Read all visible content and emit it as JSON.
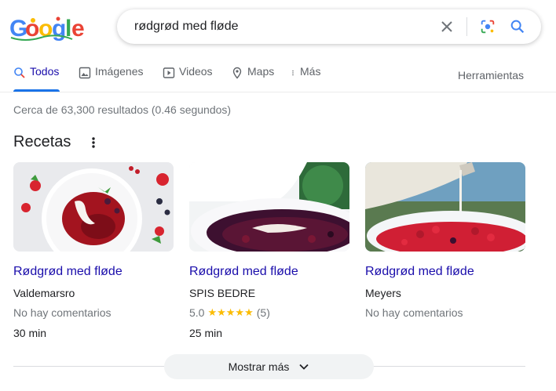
{
  "search": {
    "query": "rødgrød med fløde"
  },
  "tabs": [
    {
      "label": "Todos",
      "icon": "search-icon",
      "active": true
    },
    {
      "label": "Imágenes",
      "icon": "image-icon"
    },
    {
      "label": "Videos",
      "icon": "video-icon"
    },
    {
      "label": "Maps",
      "icon": "map-pin-icon"
    },
    {
      "label": "Más",
      "icon": "more-vert-icon"
    }
  ],
  "tools_label": "Herramientas",
  "result_stats": "Cerca de 63,300 resultados (0.46 segundos)",
  "recipes": {
    "title": "Recetas",
    "cards": [
      {
        "title": "Rødgrød med fløde",
        "source": "Valdemarsro",
        "rating_text": "No hay comentarios",
        "time": "30 min"
      },
      {
        "title": "Rødgrød med fløde",
        "source": "SPIS BEDRE",
        "rating": "5.0",
        "stars": "★★★★★",
        "reviews": "(5)",
        "time": "25 min"
      },
      {
        "title": "Rødgrød med fløde",
        "source": "Meyers",
        "rating_text": "No hay comentarios"
      }
    ]
  },
  "show_more_label": "Mostrar más",
  "colors": {
    "link": "#1a0dab",
    "accent": "#1a73e8",
    "star": "#fbbc04"
  }
}
